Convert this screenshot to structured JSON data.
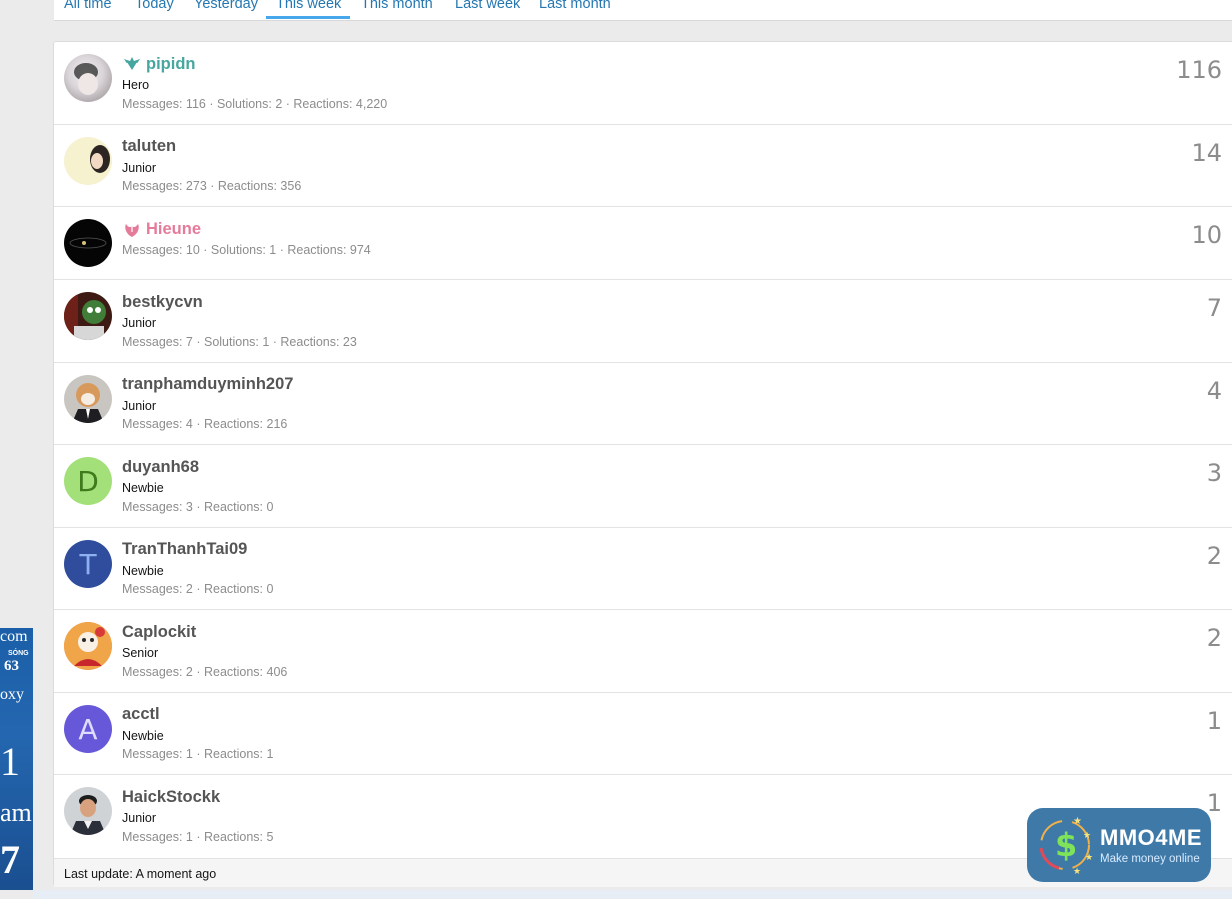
{
  "tabs": [
    {
      "label": "All time"
    },
    {
      "label": "Today"
    },
    {
      "label": "Yesterday"
    },
    {
      "label": "This week",
      "active": true
    },
    {
      "label": "This month"
    },
    {
      "label": "Last week"
    },
    {
      "label": "Last month"
    }
  ],
  "members": [
    {
      "name": "pipidn",
      "title": "Hero",
      "stats": "Messages: 116 · Solutions: 2 · Reactions: 4,220",
      "count": "116",
      "name_color": "#47a6a0",
      "icon": "wings-icon"
    },
    {
      "name": "taluten",
      "title": "Junior",
      "stats": "Messages: 273 · Reactions: 356",
      "count": "14",
      "name_color": "#555555"
    },
    {
      "name": "Hieune",
      "title": "",
      "stats": "Messages: 10 · Solutions: 1 · Reactions: 974",
      "count": "10",
      "name_color": "#e57b9b",
      "icon": "tulip-icon"
    },
    {
      "name": "bestkycvn",
      "title": "Junior",
      "stats": "Messages: 7 · Solutions: 1 · Reactions: 23",
      "count": "7",
      "name_color": "#555555"
    },
    {
      "name": "tranphamduyminh207",
      "title": "Junior",
      "stats": "Messages: 4 · Reactions: 216",
      "count": "4",
      "name_color": "#555555"
    },
    {
      "name": "duyanh68",
      "title": "Newbie",
      "stats": "Messages: 3 · Reactions: 0",
      "count": "3",
      "name_color": "#555555",
      "letter": "D",
      "avatar_bg": "#a3e07a",
      "letter_color": "#3f7a1c"
    },
    {
      "name": "TranThanhTai09",
      "title": "Newbie",
      "stats": "Messages: 2 · Reactions: 0",
      "count": "2",
      "name_color": "#555555",
      "letter": "T",
      "avatar_bg": "#2f4d9c",
      "letter_color": "#8fb0f0"
    },
    {
      "name": "Caplockit",
      "title": "Senior",
      "stats": "Messages: 2 · Reactions: 406",
      "count": "2",
      "name_color": "#555555"
    },
    {
      "name": "acctl",
      "title": "Newbie",
      "stats": "Messages: 1 · Reactions: 1",
      "count": "1",
      "name_color": "#555555",
      "letter": "A",
      "avatar_bg": "#6658d9",
      "letter_color": "#e0dcff"
    },
    {
      "name": "HaickStockk",
      "title": "Junior",
      "stats": "Messages: 1 · Reactions: 5",
      "count": "1",
      "name_color": "#555555"
    }
  ],
  "footer": {
    "last_update": "Last update: A moment ago"
  },
  "badge": {
    "title": "MMO4ME",
    "subtitle": "Make money online"
  },
  "left_ad": {
    "line1": "com",
    "line2": "SÓNG",
    "line3": "63",
    "line4": "oxy",
    "line5": "1",
    "line6": "am",
    "line7": "7"
  },
  "colors": {
    "link": "#2577b1",
    "accent": "#47a7eb",
    "badge_bg": "#3e79a8"
  }
}
